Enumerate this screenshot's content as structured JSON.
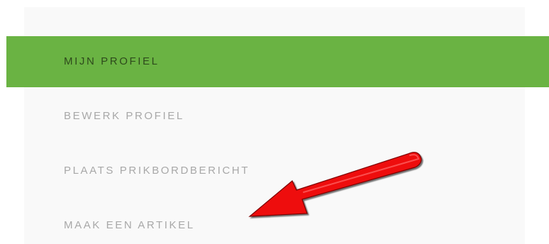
{
  "menu": {
    "items": [
      {
        "label": "MIJN PROFIEL",
        "active": true
      },
      {
        "label": "BEWERK PROFIEL",
        "active": false
      },
      {
        "label": "PLAATS PRIKBORDBERICHT",
        "active": false
      },
      {
        "label": "MAAK EEN ARTIKEL",
        "active": false
      }
    ]
  },
  "colors": {
    "active_background": "#6ab343",
    "active_text": "#2e4a1c",
    "inactive_text": "#a8a8a8",
    "panel_background": "#f9f9f9",
    "annotation_arrow": "#ee1111"
  },
  "annotation": {
    "icon": "red-arrow-icon"
  }
}
